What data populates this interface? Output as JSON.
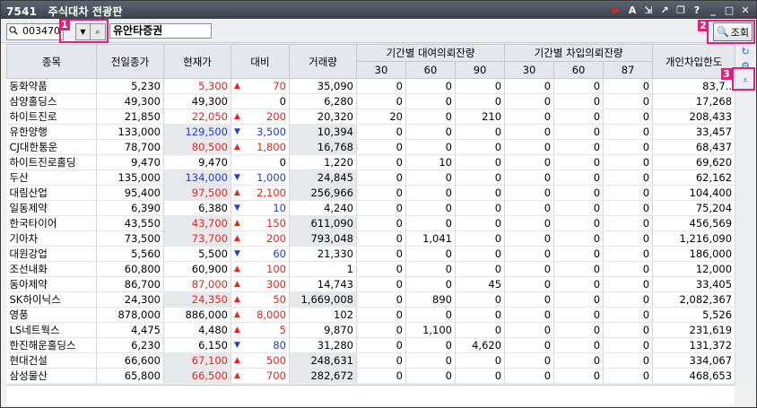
{
  "window": {
    "code": "7541",
    "title": "주식대차 전광판"
  },
  "toolbar": {
    "stock_code": "003470",
    "stock_name": "유안타증권",
    "lookup_label": "조회"
  },
  "badges": {
    "b1": "1",
    "b2": "2",
    "b3": "3"
  },
  "columns": {
    "name": "종목",
    "prev_close": "전일종가",
    "current": "현재가",
    "change": "대비",
    "volume": "거래량",
    "loan_group": "기간별 대여의뢰잔량",
    "borrow_group": "기간별 차입의뢰잔량",
    "individual": "개인차입한도",
    "sub": [
      "30",
      "60",
      "90",
      "30",
      "60",
      "87"
    ]
  },
  "rows": [
    {
      "name": "동화약품",
      "prev": "5,230",
      "cur": "5,300",
      "cur_c": "red",
      "dir": "up",
      "chg": "70",
      "vol": "35,090",
      "l30": "0",
      "l60": "0",
      "l90": "0",
      "b30": "0",
      "b60": "0",
      "b87": "0",
      "ind": "83,7.."
    },
    {
      "name": "삼양홀딩스",
      "prev": "49,300",
      "cur": "49,300",
      "cur_c": "",
      "dir": "",
      "chg": "0",
      "vol": "6,280",
      "l30": "0",
      "l60": "0",
      "l90": "0",
      "b30": "0",
      "b60": "0",
      "b87": "0",
      "ind": "17,268"
    },
    {
      "name": "하이트진로",
      "prev": "21,850",
      "cur": "22,050",
      "cur_c": "red",
      "dir": "up",
      "chg": "200",
      "vol": "20,320",
      "l30": "20",
      "l60": "0",
      "l90": "210",
      "b30": "0",
      "b60": "0",
      "b87": "0",
      "ind": "208,433"
    },
    {
      "name": "유한양행",
      "prev": "133,000",
      "cur": "129,500",
      "cur_c": "blue",
      "dir": "down",
      "chg": "3,500",
      "vol": "10,394",
      "l30": "0",
      "l60": "0",
      "l90": "0",
      "b30": "0",
      "b60": "0",
      "b87": "0",
      "ind": "33,457"
    },
    {
      "name": "CJ대한통운",
      "prev": "78,700",
      "cur": "80,500",
      "cur_c": "red",
      "dir": "up",
      "chg": "1,800",
      "vol": "16,768",
      "l30": "0",
      "l60": "0",
      "l90": "0",
      "b30": "0",
      "b60": "0",
      "b87": "0",
      "ind": "68,437"
    },
    {
      "name": "하이트진로홀딩",
      "prev": "9,470",
      "cur": "9,470",
      "cur_c": "",
      "dir": "",
      "chg": "0",
      "vol": "1,220",
      "l30": "0",
      "l60": "10",
      "l90": "0",
      "b30": "0",
      "b60": "0",
      "b87": "0",
      "ind": "69,620"
    },
    {
      "name": "두산",
      "prev": "135,000",
      "cur": "134,000",
      "cur_c": "blue",
      "dir": "down",
      "chg": "1,000",
      "vol": "24,845",
      "l30": "0",
      "l60": "0",
      "l90": "0",
      "b30": "0",
      "b60": "0",
      "b87": "0",
      "ind": "62,162"
    },
    {
      "name": "대림산업",
      "prev": "95,400",
      "cur": "97,500",
      "cur_c": "red",
      "dir": "up",
      "chg": "2,100",
      "vol": "256,966",
      "l30": "0",
      "l60": "0",
      "l90": "0",
      "b30": "0",
      "b60": "0",
      "b87": "0",
      "ind": "104,400"
    },
    {
      "name": "일동제약",
      "prev": "6,390",
      "cur": "6,380",
      "cur_c": "",
      "dir": "down",
      "chg": "10",
      "vol": "4,240",
      "l30": "0",
      "l60": "0",
      "l90": "0",
      "b30": "0",
      "b60": "0",
      "b87": "0",
      "ind": "75,204"
    },
    {
      "name": "한국타이어",
      "prev": "43,550",
      "cur": "43,700",
      "cur_c": "red",
      "dir": "up",
      "chg": "150",
      "vol": "611,090",
      "l30": "0",
      "l60": "0",
      "l90": "0",
      "b30": "0",
      "b60": "0",
      "b87": "0",
      "ind": "456,569"
    },
    {
      "name": "기아차",
      "prev": "73,500",
      "cur": "73,700",
      "cur_c": "red",
      "dir": "up",
      "chg": "200",
      "vol": "793,048",
      "l30": "0",
      "l60": "1,041",
      "l90": "0",
      "b30": "0",
      "b60": "0",
      "b87": "0",
      "ind": "1,216,090"
    },
    {
      "name": "대원강업",
      "prev": "5,560",
      "cur": "5,500",
      "cur_c": "",
      "dir": "down",
      "chg": "60",
      "vol": "21,330",
      "l30": "0",
      "l60": "0",
      "l90": "0",
      "b30": "0",
      "b60": "0",
      "b87": "0",
      "ind": "186,000"
    },
    {
      "name": "조선내화",
      "prev": "60,800",
      "cur": "60,900",
      "cur_c": "",
      "dir": "up",
      "chg": "100",
      "vol": "1",
      "l30": "0",
      "l60": "0",
      "l90": "0",
      "b30": "0",
      "b60": "0",
      "b87": "0",
      "ind": "12,000"
    },
    {
      "name": "동아제약",
      "prev": "86,700",
      "cur": "87,000",
      "cur_c": "red",
      "dir": "up",
      "chg": "300",
      "vol": "14,743",
      "l30": "0",
      "l60": "0",
      "l90": "45",
      "b30": "0",
      "b60": "0",
      "b87": "0",
      "ind": "33,405"
    },
    {
      "name": "SK하이닉스",
      "prev": "24,300",
      "cur": "24,350",
      "cur_c": "red",
      "dir": "up",
      "chg": "50",
      "vol": "1,669,008",
      "l30": "0",
      "l60": "890",
      "l90": "0",
      "b30": "0",
      "b60": "0",
      "b87": "0",
      "ind": "2,082,367"
    },
    {
      "name": "영풍",
      "prev": "878,000",
      "cur": "886,000",
      "cur_c": "",
      "dir": "up",
      "chg": "8,000",
      "vol": "102",
      "l30": "0",
      "l60": "0",
      "l90": "0",
      "b30": "0",
      "b60": "0",
      "b87": "0",
      "ind": "5,526"
    },
    {
      "name": "LS네트웍스",
      "prev": "4,475",
      "cur": "4,480",
      "cur_c": "",
      "dir": "up",
      "chg": "5",
      "vol": "9,870",
      "l30": "0",
      "l60": "1,100",
      "l90": "0",
      "b30": "0",
      "b60": "0",
      "b87": "0",
      "ind": "231,619"
    },
    {
      "name": "한진해운홀딩스",
      "prev": "6,230",
      "cur": "6,150",
      "cur_c": "",
      "dir": "down",
      "chg": "80",
      "vol": "31,280",
      "l30": "0",
      "l60": "0",
      "l90": "4,620",
      "b30": "0",
      "b60": "0",
      "b87": "0",
      "ind": "131,372"
    },
    {
      "name": "현대건설",
      "prev": "66,600",
      "cur": "67,100",
      "cur_c": "red",
      "dir": "up",
      "chg": "500",
      "vol": "248,631",
      "l30": "0",
      "l60": "0",
      "l90": "0",
      "b30": "0",
      "b60": "0",
      "b87": "0",
      "ind": "334,067"
    },
    {
      "name": "삼성물산",
      "prev": "65,800",
      "cur": "66,500",
      "cur_c": "red",
      "dir": "up",
      "chg": "700",
      "vol": "282,672",
      "l30": "0",
      "l60": "0",
      "l90": "0",
      "b30": "0",
      "b60": "0",
      "b87": "0",
      "ind": "468,653"
    }
  ],
  "colors": {
    "up": "#e6261b",
    "down": "#1e3fd2",
    "highlight": "#e0207a"
  },
  "icons": {
    "play": "play-icon",
    "font": "font-icon",
    "expand": "expand-icon",
    "fullscreen": "fullscreen-icon",
    "restore": "restore-icon",
    "help": "help-icon",
    "minimize": "minimize-icon",
    "maximize": "maximize-icon",
    "close": "close-icon"
  }
}
